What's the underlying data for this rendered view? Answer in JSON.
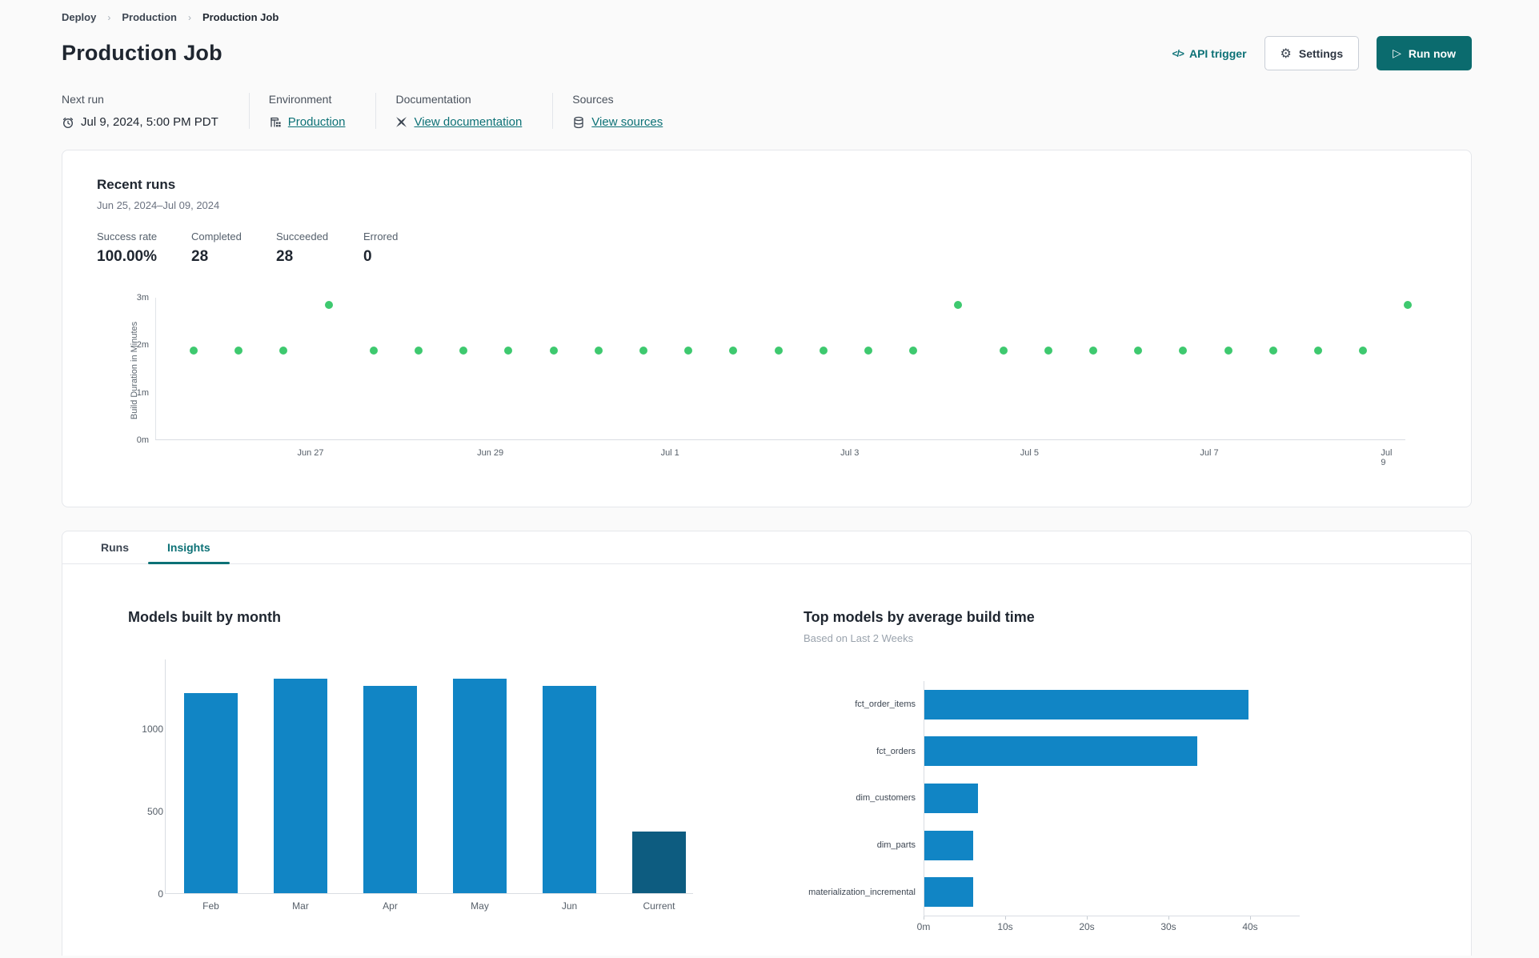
{
  "breadcrumb": {
    "items": [
      "Deploy",
      "Production",
      "Production Job"
    ]
  },
  "header": {
    "title": "Production Job",
    "api_trigger_label": "API trigger",
    "api_icon_glyph": "</>",
    "settings_label": "Settings",
    "run_now_label": "Run now"
  },
  "meta": {
    "columns": [
      {
        "label": "Next run",
        "value": "Jul 9, 2024, 5:00 PM PDT",
        "icon": "clock-icon",
        "is_link": false
      },
      {
        "label": "Environment",
        "value": "Production",
        "icon": "environment-icon",
        "is_link": true
      },
      {
        "label": "Documentation",
        "value": "View documentation",
        "icon": "dbt-logo-icon",
        "is_link": true
      },
      {
        "label": "Sources",
        "value": "View sources",
        "icon": "database-icon",
        "is_link": true
      }
    ]
  },
  "recent_runs": {
    "title": "Recent runs",
    "date_range": "Jun 25, 2024–Jul 09, 2024",
    "stats": [
      {
        "label": "Success rate",
        "value": "100.00%"
      },
      {
        "label": "Completed",
        "value": "28"
      },
      {
        "label": "Succeeded",
        "value": "28"
      },
      {
        "label": "Errored",
        "value": "0"
      }
    ]
  },
  "tabs": [
    {
      "label": "Runs",
      "active": false
    },
    {
      "label": "Insights",
      "active": true
    }
  ],
  "colors": {
    "accent_teal": "#0b6b6e",
    "link_teal": "#0c7176",
    "dot_green": "#3ec96f",
    "bar_blue": "#1185c5",
    "bar_dark_blue": "#0d5c80"
  },
  "chart_data": [
    {
      "type": "scatter",
      "name": "build-duration-by-run",
      "ylabel": "Build Duration in Minutes",
      "y_ticks": [
        "0m",
        "1m",
        "2m",
        "3m"
      ],
      "ylim_minutes": [
        0,
        3.1
      ],
      "x_tick_labels": [
        "Jun 27",
        "Jun 29",
        "Jul 1",
        "Jul 3",
        "Jul 5",
        "Jul 7",
        "Jul 9"
      ],
      "x_range": [
        "Jun 25, 2024",
        "Jul 09, 2024"
      ],
      "runs_per_day": 2,
      "point_minutes": [
        1.95,
        1.95,
        1.95,
        2.95,
        1.95,
        1.95,
        1.95,
        1.95,
        1.95,
        1.95,
        1.95,
        1.95,
        1.95,
        1.95,
        1.95,
        1.95,
        1.95,
        2.95,
        1.95,
        1.95,
        1.95,
        1.95,
        1.95,
        1.95,
        1.95,
        1.95,
        1.95,
        2.95
      ]
    },
    {
      "type": "bar",
      "title": "Models built by month",
      "categories": [
        "Feb",
        "Mar",
        "Apr",
        "May",
        "Jun",
        "Current"
      ],
      "values": [
        1210,
        1300,
        1255,
        1300,
        1255,
        375
      ],
      "y_ticks": [
        0,
        500,
        1000
      ],
      "ylim": [
        0,
        1420
      ],
      "highlight_index": 5
    },
    {
      "type": "bar-horizontal",
      "title": "Top models by average build time",
      "subtitle": "Based on Last 2 Weeks",
      "categories": [
        "fct_order_items",
        "fct_orders",
        "dim_customers",
        "dim_parts",
        "materialization_incremental"
      ],
      "values_seconds": [
        39.7,
        33.4,
        6.6,
        6.0,
        6.0
      ],
      "x_ticks": [
        "0m",
        "10s",
        "20s",
        "30s",
        "40s"
      ],
      "xlim_seconds": [
        0,
        44
      ]
    }
  ]
}
